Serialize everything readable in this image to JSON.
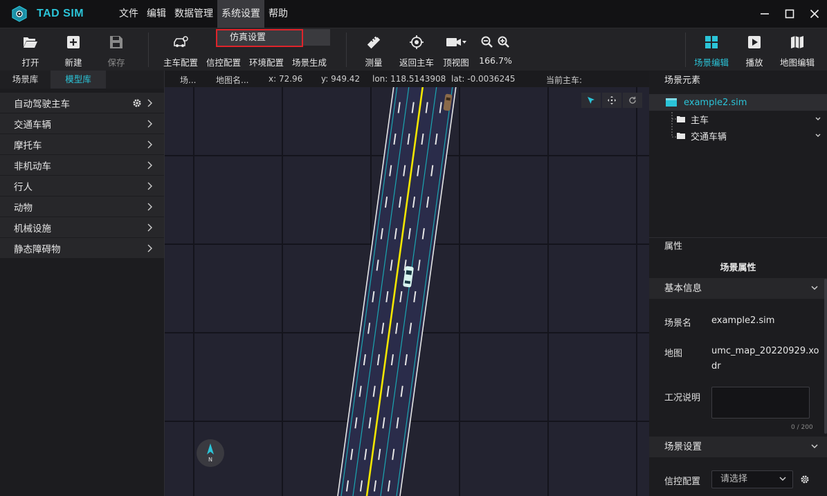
{
  "app": {
    "name": "TAD SIM"
  },
  "menubar": {
    "items": [
      "文件",
      "编辑",
      "数据管理",
      "系统设置",
      "帮助"
    ],
    "active": "系统设置",
    "dropdown": {
      "item": "仿真设置"
    }
  },
  "toolbar": {
    "open": "打开",
    "new": "新建",
    "save": "保存",
    "ego_config": "主车配置",
    "signal_config": "信控配置",
    "env_config": "环境配置",
    "scene_gen": "场景生成",
    "measure": "测量",
    "back_to_ego": "返回主车",
    "top_view": "顶视图",
    "zoom": "166.7%",
    "scene_edit": "场景编辑",
    "play": "播放",
    "map_edit": "地图编辑"
  },
  "left_panel": {
    "tabs": [
      "场景库",
      "模型库"
    ],
    "active_tab": "模型库",
    "categories": [
      "自动驾驶主车",
      "交通车辆",
      "摩托车",
      "非机动车",
      "行人",
      "动物",
      "机械设施",
      "静态障碍物"
    ]
  },
  "infobar": {
    "scene": "场...",
    "map": "地图名...",
    "x": "x: 72.96",
    "y": "y: 949.42",
    "lon": "lon: 118.5143908",
    "lat": "lat: -0.0036245",
    "ego": "当前主车:"
  },
  "compass": {
    "label": "N"
  },
  "right_panel": {
    "scene_elements_title": "场景元素",
    "tree_root": "example2.sim",
    "tree_children": [
      "主车",
      "交通车辆"
    ],
    "props_title": "属性",
    "scene_props_title": "场景属性",
    "basic_info": "基本信息",
    "scene_name_label": "场景名",
    "scene_name_value": "example2.sim",
    "map_label": "地图",
    "map_value": "umc_map_20220929.xodr",
    "desc_label": "工况说明",
    "desc_counter": "0 / 200",
    "scene_settings": "场景设置",
    "signal_label": "信控配置",
    "signal_placeholder": "请选择"
  },
  "colors": {
    "accent": "#2bc4d8",
    "highlight_border": "#e0242b",
    "road": "#2a2c4a",
    "center_line": "#f2e600",
    "lane_line": "#1aa6b2"
  }
}
